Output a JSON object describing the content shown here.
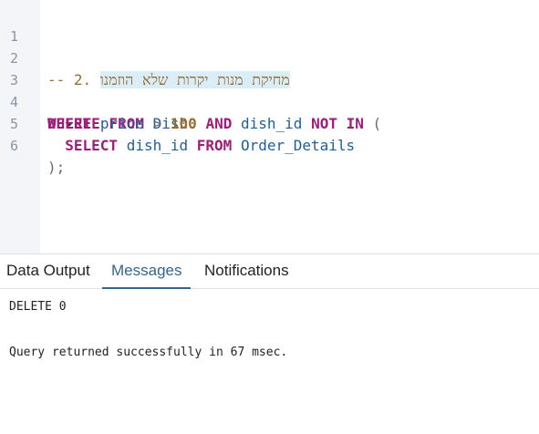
{
  "editor": {
    "line_numbers": [
      "1",
      "2",
      "3",
      "4",
      "5",
      "6"
    ],
    "fold_icon": "chevron-down-icon",
    "line2": {
      "comment_prefix": "-- 2. ",
      "comment_text": "מחיקת מנות יקרות שלא הוזמנו"
    },
    "line3": {
      "kw1": "DELETE",
      "kw2": "FROM",
      "table": "Dish"
    },
    "line4": {
      "kw_where": "WHERE",
      "col1": "price",
      "op": ">",
      "num": "100",
      "kw_and": "AND",
      "col2": "dish_id",
      "kw_not": "NOT",
      "kw_in": "IN",
      "paren": "("
    },
    "line5": {
      "kw_select": "SELECT",
      "col": "dish_id",
      "kw_from": "FROM",
      "table": "Order_Details"
    },
    "line6": {
      "text": ");"
    }
  },
  "tabs": [
    {
      "label": "Data Output",
      "active": false
    },
    {
      "label": "Messages",
      "active": true
    },
    {
      "label": "Notifications",
      "active": false
    }
  ],
  "messages": {
    "line1": "DELETE 0",
    "line2": "Query returned successfully in 67 msec."
  },
  "colors": {
    "accent": "#326690",
    "keyword": "#9e1c7a",
    "identifier": "#1f5f99",
    "number": "#9b6a2b",
    "gutter_bg": "#f3f5f9"
  }
}
